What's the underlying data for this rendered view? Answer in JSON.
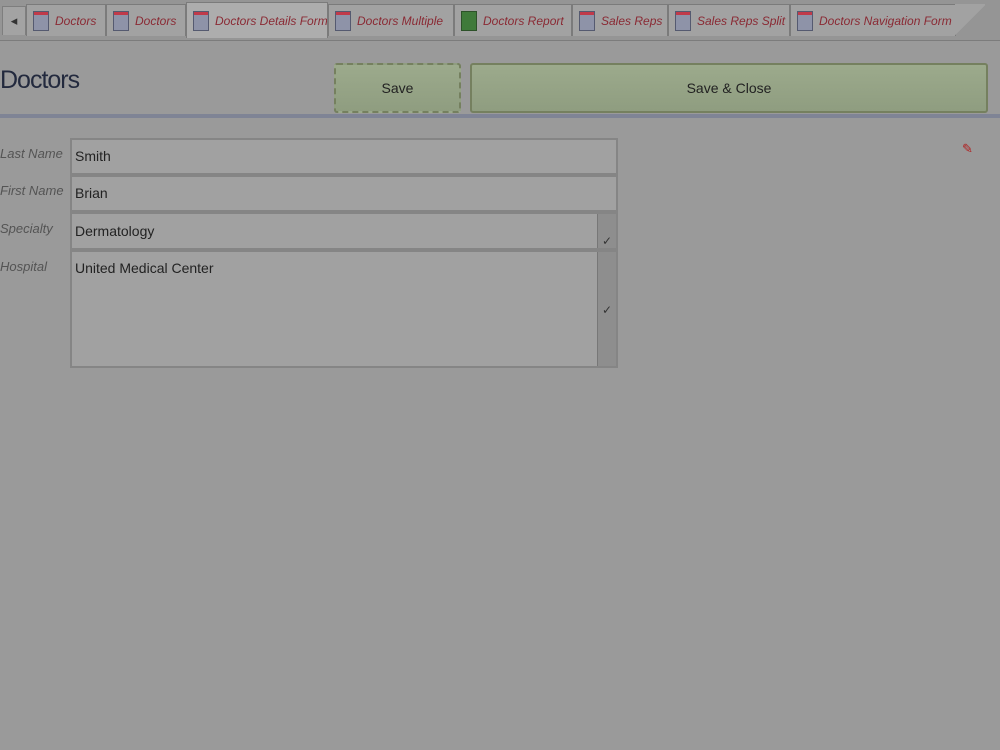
{
  "tabs": [
    {
      "label": "Doctors",
      "icon": "table-icon"
    },
    {
      "label": "Doctors",
      "icon": "table-icon"
    },
    {
      "label": "Doctors Details Form",
      "icon": "form-icon",
      "active": true
    },
    {
      "label": "Doctors Multiple",
      "icon": "form-icon"
    },
    {
      "label": "Doctors Report",
      "icon": "report-icon"
    },
    {
      "label": "Sales Reps",
      "icon": "table-icon"
    },
    {
      "label": "Sales Reps Split",
      "icon": "form-icon"
    },
    {
      "label": "Doctors Navigation Form",
      "icon": "form-icon"
    }
  ],
  "header": {
    "title": "Doctors",
    "save_label": "Save",
    "save_close_label": "Save & Close"
  },
  "form": {
    "last_name_label": "Last Name",
    "last_name_value": "Smith",
    "first_name_label": "First Name",
    "first_name_value": "Brian",
    "specialty_label": "Specialty",
    "specialty_value": "Dermatology",
    "hospital_label": "Hospital",
    "hospital_value": "United Medical Center"
  },
  "colors": {
    "background": "#9a9a9a",
    "button": "#96a486",
    "tab_text": "#8a2a34",
    "title": "#232a3e"
  }
}
